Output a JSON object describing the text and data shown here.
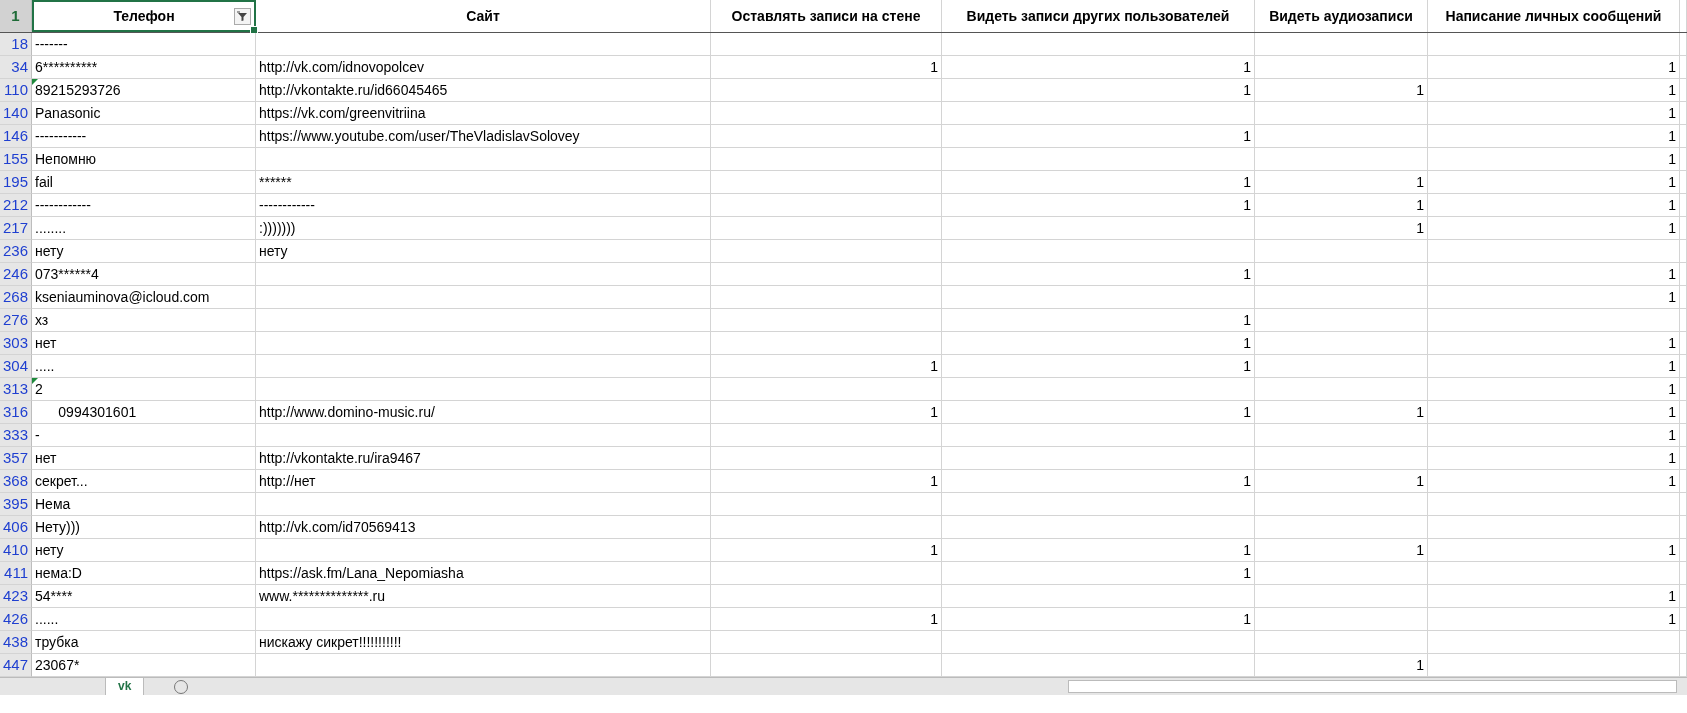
{
  "header_row_number": "1",
  "columns": [
    {
      "label": "Телефон",
      "filter_active": true,
      "selected": true
    },
    {
      "label": "Сайт",
      "filter_active": false,
      "selected": false
    },
    {
      "label": "Оставлять записи на стене",
      "filter_active": false,
      "selected": false
    },
    {
      "label": "Видеть записи других пользователей",
      "filter_active": false,
      "selected": false
    },
    {
      "label": "Видеть аудиозаписи",
      "filter_active": false,
      "selected": false
    },
    {
      "label": "Написание личных сообщений",
      "filter_active": false,
      "selected": false
    }
  ],
  "rows": [
    {
      "row_number": "18",
      "flagged": false,
      "cells": [
        "-------",
        "",
        "",
        "",
        "",
        ""
      ]
    },
    {
      "row_number": "34",
      "flagged": false,
      "cells": [
        "6**********",
        "http://vk.com/idnovopolcev",
        "1",
        "1",
        "",
        "1"
      ]
    },
    {
      "row_number": "110",
      "flagged": true,
      "cells": [
        "89215293726",
        "http://vkontakte.ru/id66045465",
        "",
        "1",
        "1",
        "1"
      ]
    },
    {
      "row_number": "140",
      "flagged": false,
      "cells": [
        "Panasonic",
        "https://vk.com/greenvitriina",
        "",
        "",
        "",
        "1"
      ]
    },
    {
      "row_number": "146",
      "flagged": false,
      "cells": [
        "-----------",
        "https://www.youtube.com/user/TheVladislavSolovey",
        "",
        "1",
        "",
        "1"
      ]
    },
    {
      "row_number": "155",
      "flagged": false,
      "cells": [
        "Непомню",
        "",
        "",
        "",
        "",
        "1"
      ]
    },
    {
      "row_number": "195",
      "flagged": false,
      "cells": [
        "fail",
        "******",
        "",
        "1",
        "1",
        "1"
      ]
    },
    {
      "row_number": "212",
      "flagged": false,
      "cells": [
        "------------",
        "------------",
        "",
        "1",
        "1",
        "1"
      ]
    },
    {
      "row_number": "217",
      "flagged": false,
      "cells": [
        "........",
        ":)))))))",
        "",
        "",
        "1",
        "1"
      ]
    },
    {
      "row_number": "236",
      "flagged": false,
      "cells": [
        "нету",
        "нету",
        "",
        "",
        "",
        ""
      ]
    },
    {
      "row_number": "246",
      "flagged": false,
      "cells": [
        "073******4",
        "",
        "",
        "1",
        "",
        "1"
      ]
    },
    {
      "row_number": "268",
      "flagged": false,
      "cells": [
        "kseniauminova@icloud.com",
        "",
        "",
        "",
        "",
        "1"
      ]
    },
    {
      "row_number": "276",
      "flagged": false,
      "cells": [
        "хз",
        "",
        "",
        "1",
        "",
        ""
      ]
    },
    {
      "row_number": "303",
      "flagged": false,
      "cells": [
        "нет",
        "",
        "",
        "1",
        "",
        "1"
      ]
    },
    {
      "row_number": "304",
      "flagged": false,
      "cells": [
        ".....",
        "",
        "1",
        "1",
        "",
        "1"
      ]
    },
    {
      "row_number": "313",
      "flagged": true,
      "cells": [
        "2",
        "",
        "",
        "",
        "",
        "1"
      ]
    },
    {
      "row_number": "316",
      "flagged": false,
      "cells": [
        "      0994301601",
        "http://www.domino-music.ru/",
        "1",
        "1",
        "1",
        "1"
      ]
    },
    {
      "row_number": "333",
      "flagged": false,
      "cells": [
        "-",
        "",
        "",
        "",
        "",
        "1"
      ]
    },
    {
      "row_number": "357",
      "flagged": false,
      "cells": [
        "нет",
        "http://vkontakte.ru/ira9467",
        "",
        "",
        "",
        "1"
      ]
    },
    {
      "row_number": "368",
      "flagged": false,
      "cells": [
        "секрет...",
        "http://нет",
        "1",
        "1",
        "1",
        "1"
      ]
    },
    {
      "row_number": "395",
      "flagged": false,
      "cells": [
        "Нема",
        "",
        "",
        "",
        "",
        ""
      ]
    },
    {
      "row_number": "406",
      "flagged": false,
      "cells": [
        "Нету)))",
        "http://vk.com/id70569413",
        "",
        "",
        "",
        ""
      ]
    },
    {
      "row_number": "410",
      "flagged": false,
      "cells": [
        "нету",
        "",
        "1",
        "1",
        "1",
        "1"
      ]
    },
    {
      "row_number": "411",
      "flagged": false,
      "cells": [
        "нема:D",
        "https://ask.fm/Lana_Nepomiasha",
        "",
        "1",
        "",
        ""
      ]
    },
    {
      "row_number": "423",
      "flagged": false,
      "cells": [
        "54****",
        "www.**************.ru",
        "",
        "",
        "",
        "1"
      ]
    },
    {
      "row_number": "426",
      "flagged": false,
      "cells": [
        "......",
        "",
        "1",
        "1",
        "",
        "1"
      ]
    },
    {
      "row_number": "438",
      "flagged": false,
      "cells": [
        "трубка",
        "нискажу сикрет!!!!!!!!!!!",
        "",
        "",
        "",
        ""
      ]
    },
    {
      "row_number": "447",
      "flagged": false,
      "cells": [
        "23067*",
        "",
        "",
        "",
        "1",
        ""
      ]
    }
  ],
  "sheet_tabs": [
    {
      "label": "vk",
      "selected": true
    }
  ]
}
